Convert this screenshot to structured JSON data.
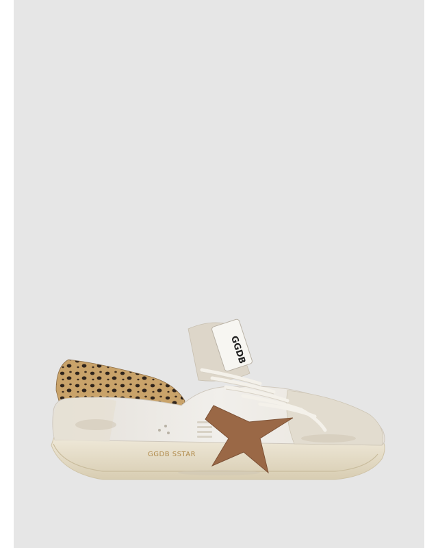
{
  "product": {
    "tongue_logo": "GGDB",
    "side_print": "GGDB SSTAR",
    "colors": {
      "frame_background": "#e6e6e6",
      "page_background": "#ffffff",
      "upper": "#ece9e3",
      "suede": "#e2dccf",
      "sole": "#e9e1cc",
      "star": "#9a6846",
      "leopard_base": "#c9a36a",
      "leopard_spot": "#2f241c"
    }
  }
}
